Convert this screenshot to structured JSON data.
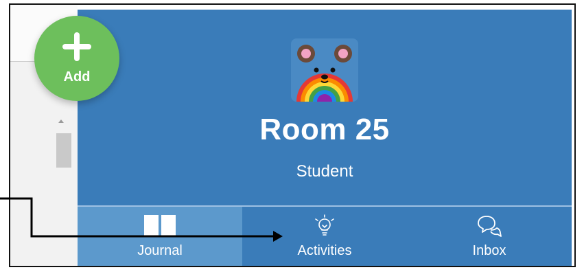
{
  "fab": {
    "label": "Add",
    "icon": "plus-icon",
    "color": "#6dbf5c"
  },
  "profile": {
    "title": "Room 25",
    "subtitle": "Student",
    "avatar_icon": "rainbow-bear-avatar"
  },
  "tabs": [
    {
      "label": "Journal",
      "icon": "book-icon",
      "active": true
    },
    {
      "label": "Activities",
      "icon": "lightbulb-icon",
      "active": false
    },
    {
      "label": "Inbox",
      "icon": "chat-bubbles-icon",
      "active": false
    }
  ],
  "colors": {
    "panel": "#3a7cb9",
    "active_tab": "#5c99cc",
    "fab": "#6dbf5c",
    "annotation": "#000000"
  }
}
